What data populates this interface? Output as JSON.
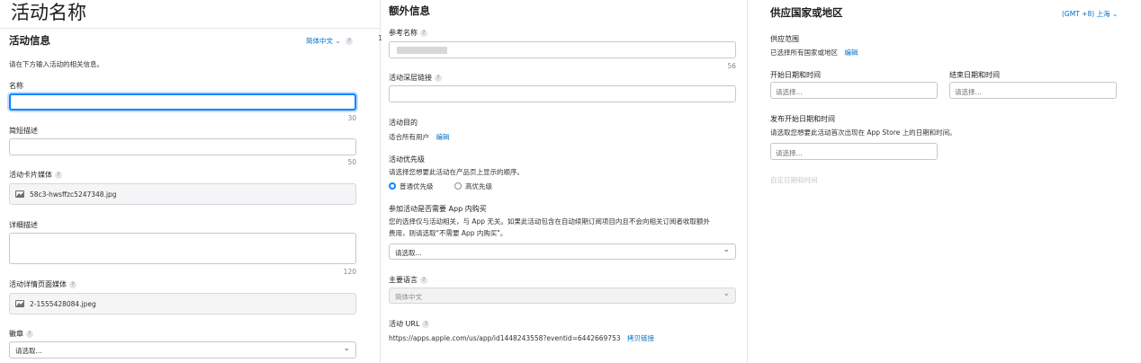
{
  "page": {
    "header": "活动名称"
  },
  "left": {
    "section_title": "活动信息",
    "language": "简体中文",
    "intro": "请在下方输入活动的相关信息。",
    "name": {
      "label": "名称",
      "value": "",
      "count": "30"
    },
    "short_desc": {
      "label": "简短描述",
      "value": "",
      "count": "50"
    },
    "card_media": {
      "label": "活动卡片媒体",
      "file": "58c3-hwsffzc5247348.jpg"
    },
    "detail_desc": {
      "label": "详细描述",
      "value": "",
      "count": "120"
    },
    "detail_media": {
      "label": "活动详情页面媒体",
      "file": "2-1555428084.jpeg"
    },
    "badge": {
      "label": "徽章",
      "placeholder": "请选取..."
    }
  },
  "middle": {
    "section_title": "额外信息",
    "ref_name": {
      "label": "参考名称",
      "count": "56"
    },
    "deep_link": {
      "label": "活动深层链接",
      "value": ""
    },
    "purpose": {
      "label": "活动目的",
      "value": "适合所有用户",
      "edit": "编辑"
    },
    "priority": {
      "label": "活动优先级",
      "desc": "请选择您想要此活动在产品页上显示的顺序。",
      "options": [
        "普通优先级",
        "高优先级"
      ],
      "selected": 0
    },
    "iap": {
      "label": "参加活动是否需要 App 内购买",
      "desc_line1": "您的选择仅与活动相关，与 App 无关。如果此活动包含在自动续期订阅项目内且不会向相关订阅者收取额外",
      "desc_line2": "费用，则请选取\"不需要 App 内购买\"。",
      "placeholder": "请选取..."
    },
    "primary_lang": {
      "label": "主要语言",
      "value": "简体中文"
    },
    "url": {
      "label": "活动 URL",
      "value": "https://apps.apple.com/us/app/id1448243558?eventid=6442669753",
      "copy": "拷贝链接"
    }
  },
  "right": {
    "section_title": "供应国家或地区",
    "timezone": "(GMT +8) 上海",
    "range_label": "供应范围",
    "range_value": "已选择所有国家或地区",
    "range_edit": "编辑",
    "start_label": "开始日期和时间",
    "start_placeholder": "请选择...",
    "end_label": "结束日期和时间",
    "end_placeholder": "请选择...",
    "publish_label": "发布开始日期和时间",
    "publish_desc": "请选取您想要此活动首次出现在 App Store 上的日期和时间。",
    "publish_placeholder": "请选择...",
    "custom_datetime": "自定日期和时间"
  }
}
